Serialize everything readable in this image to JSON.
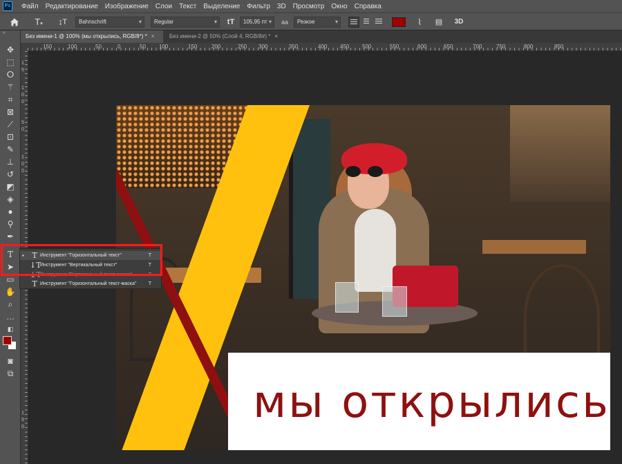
{
  "menubar": {
    "logo": "Ps",
    "items": [
      "Файл",
      "Редактирование",
      "Изображение",
      "Слои",
      "Текст",
      "Выделение",
      "Фильтр",
      "3D",
      "Просмотр",
      "Окно",
      "Справка"
    ]
  },
  "options": {
    "home_icon": "home-icon",
    "tool_icon": "T",
    "orient_icon": "↨T",
    "font_family": "Bahnschrift",
    "font_style": "Regular",
    "size_icon": "tT",
    "font_size": "105,95 пт",
    "aa_label": "aa",
    "antialias": "Резкое",
    "text_color": "#a00000",
    "three_d": "3D"
  },
  "tabs": [
    {
      "label": "Без имени-1 @ 100% (мы открылись, RGB/8*) *",
      "close": "×"
    },
    {
      "label": "Без имени-2 @ 50% (Слой 4, RGB/8#) *",
      "close": "×"
    }
  ],
  "ruler": {
    "h_labels": [
      "150",
      "100",
      "50",
      "0",
      "50",
      "100",
      "150",
      "200",
      "250",
      "300",
      "350",
      "400",
      "450",
      "500",
      "550",
      "600",
      "650",
      "700",
      "750",
      "800",
      "850"
    ],
    "v_labels": [
      "1",
      "5",
      "1",
      "0",
      "0",
      "5",
      "0",
      "1",
      "0",
      "0",
      "1",
      "5",
      "0"
    ]
  },
  "flyout": {
    "items": [
      {
        "bullet": "▪",
        "icon": "T",
        "label": "Инструмент \"Горизонтальный текст\"",
        "key": "T"
      },
      {
        "bullet": "",
        "icon": "↓T",
        "label": "Инструмент \"Вертикальный текст\"",
        "key": "T"
      },
      {
        "bullet": "",
        "icon": "⤓T",
        "label": "Инструмент \"Вертикальный текст-маска\"",
        "key": "T"
      },
      {
        "bullet": "",
        "icon": "T",
        "label": "Инструмент \"Горизонтальный текст-маска\"",
        "key": "T"
      }
    ]
  },
  "canvas": {
    "headline": "мы открылись"
  },
  "colors": {
    "foreground": "#a00000",
    "background": "#ffffff",
    "accent_yellow": "#ffc10e",
    "brand_red": "#8f1010"
  }
}
